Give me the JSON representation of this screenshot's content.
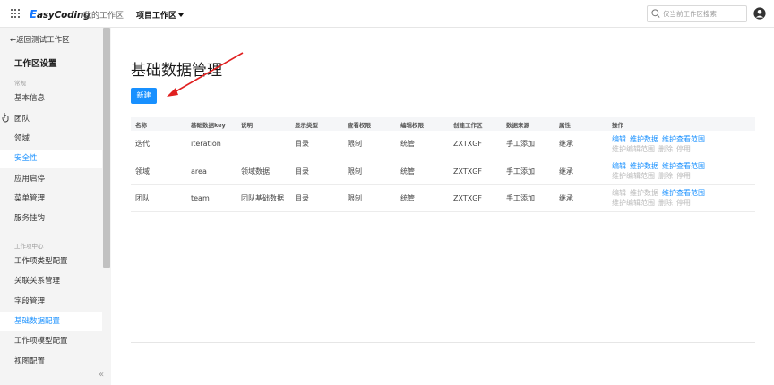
{
  "topbar": {
    "logo_letter": "E",
    "logo_rest": "asyCoding",
    "my_workspace": "我的工作区",
    "project_workspace": "项目工作区",
    "search_placeholder": "仅当前工作区搜索"
  },
  "sidebar": {
    "back": "←返回测试工作区",
    "title": "工作区设置",
    "group1": "常规",
    "group2": "工作项中心",
    "items": [
      {
        "label": "基本信息"
      },
      {
        "label": "团队"
      },
      {
        "label": "领域"
      },
      {
        "label": "安全性"
      },
      {
        "label": "应用启停"
      },
      {
        "label": "菜单管理"
      },
      {
        "label": "服务挂钩"
      },
      {
        "label": "工作项类型配置"
      },
      {
        "label": "关联关系管理"
      },
      {
        "label": "字段管理"
      },
      {
        "label": "基础数据配置"
      },
      {
        "label": "工作项模型配置"
      },
      {
        "label": "视图配置"
      }
    ],
    "collapse": "«"
  },
  "main": {
    "title": "基础数据管理",
    "new_button": "新建",
    "columns": [
      "名称",
      "基础数据key",
      "说明",
      "显示类型",
      "查看权限",
      "编辑权限",
      "创建工作区",
      "数据来源",
      "属性",
      "操作"
    ],
    "rows": [
      {
        "name": "迭代",
        "key": "iteration",
        "desc": "",
        "display": "目录",
        "view": "限制",
        "edit": "统管",
        "workspace": "ZXTXGF",
        "source": "手工添加",
        "attr": "继承",
        "ops1": [
          {
            "t": "编辑",
            "on": true
          },
          {
            "t": "维护数据",
            "on": true
          },
          {
            "t": "维护查看范围",
            "on": true
          }
        ],
        "ops2": [
          {
            "t": "维护编辑范围",
            "on": false
          },
          {
            "t": "删除",
            "on": false
          },
          {
            "t": "停用",
            "on": false
          }
        ]
      },
      {
        "name": "领域",
        "key": "area",
        "desc": "领域数据",
        "display": "目录",
        "view": "限制",
        "edit": "统管",
        "workspace": "ZXTXGF",
        "source": "手工添加",
        "attr": "继承",
        "ops1": [
          {
            "t": "编辑",
            "on": true
          },
          {
            "t": "维护数据",
            "on": true
          },
          {
            "t": "维护查看范围",
            "on": true
          }
        ],
        "ops2": [
          {
            "t": "维护编辑范围",
            "on": false
          },
          {
            "t": "删除",
            "on": false
          },
          {
            "t": "停用",
            "on": false
          }
        ]
      },
      {
        "name": "团队",
        "key": "team",
        "desc": "团队基础数据",
        "display": "目录",
        "view": "限制",
        "edit": "统管",
        "workspace": "ZXTXGF",
        "source": "手工添加",
        "attr": "继承",
        "ops1": [
          {
            "t": "编辑",
            "on": false
          },
          {
            "t": "维护数据",
            "on": false
          },
          {
            "t": "维护查看范围",
            "on": true
          }
        ],
        "ops2": [
          {
            "t": "维护编辑范围",
            "on": false
          },
          {
            "t": "删除",
            "on": false
          },
          {
            "t": "停用",
            "on": false
          }
        ]
      }
    ]
  },
  "colors": {
    "accent": "#1890ff",
    "annotation_arrow": "#e02020",
    "sidebar_bg": "#f4f4f4"
  }
}
